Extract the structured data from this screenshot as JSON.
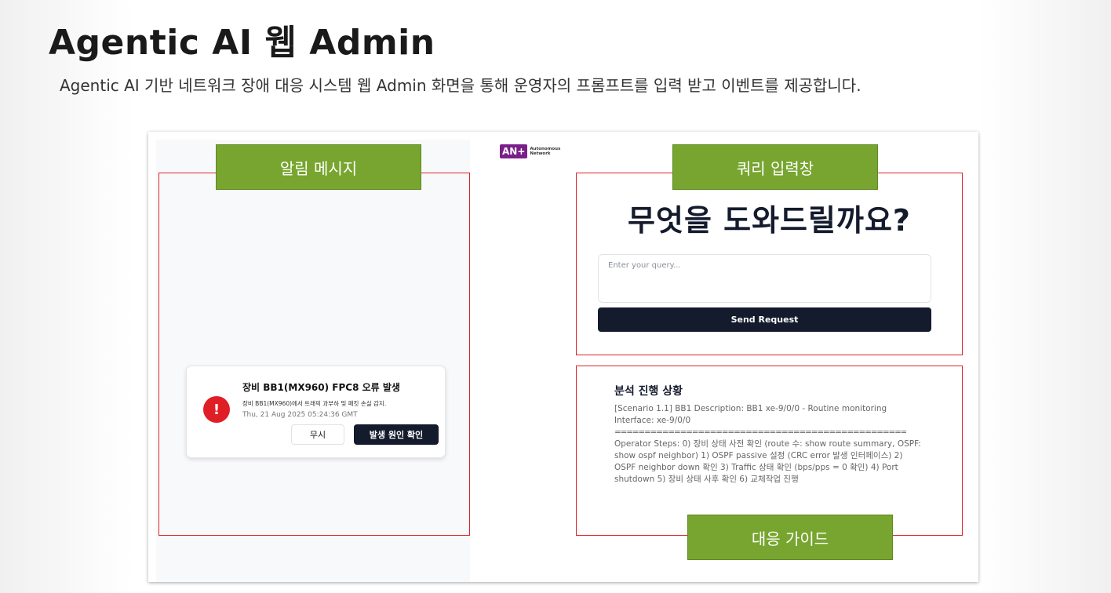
{
  "slide": {
    "title": "Agentic AI 웹 Admin",
    "description": "Agentic AI 기반 네트워크 장애 대응 시스템 웹 Admin 화면을 통해 운영자의 프롬프트를 입력 받고 이벤트를 제공합니다."
  },
  "callouts": {
    "alert_messages": "알림 메시지",
    "query_input": "쿼리 입력창",
    "response_guide": "대응 가이드"
  },
  "logo": {
    "mark": "AN+",
    "text_line1": "Autonomous",
    "text_line2": "Network",
    "brand_color": "#7a1f8a"
  },
  "alert": {
    "icon": "exclamation-icon",
    "title": "장비 BB1(MX960) FPC8 오류 발생",
    "body": "장비 BB1(MX960)에서 트래픽 과부하 및 패킷 손실 감지.",
    "timestamp": "Thu, 21 Aug 2025 05:24:36 GMT",
    "ignore_label": "무시",
    "cause_label": "발생 원인 확인",
    "icon_color": "#e01e26"
  },
  "query": {
    "heading": "무엇을 도와드릴까요?",
    "placeholder": "Enter your query...",
    "send_label": "Send Request"
  },
  "analysis": {
    "title": "분석 진행 상황",
    "scenario": "[Scenario 1.1] BB1 Description: BB1 xe-9/0/0 - Routine monitoring Interface: xe-9/0/0",
    "separator": "==================================================",
    "steps": "Operator Steps: 0) 장비 상태 사전 확인 (route 수: show route summary, OSPF: show ospf neighbor) 1) OSPF passive 설정 (CRC error 발생 인터페이스) 2) OSPF neighbor down 확인 3) Traffic 상태 확인 (bps/pps = 0 확인) 4) Port shutdown 5) 장비 상태 사후 확인 6) 교체작업 진행"
  },
  "colors": {
    "highlight_border": "#d9262a",
    "callout_fill": "#77a52f",
    "dark_button": "#141b2d"
  }
}
